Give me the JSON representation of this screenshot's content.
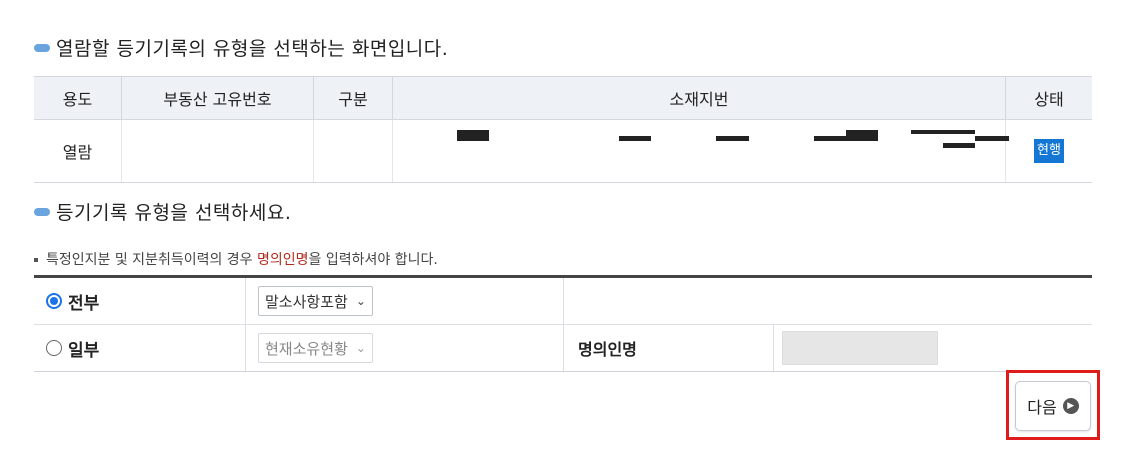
{
  "titles": {
    "main": "열람할 등기기록의 유형을 선택하는 화면입니다.",
    "select_type": "등기기록 유형을 선택하세요."
  },
  "info_table": {
    "headers": [
      "용도",
      "부동산 고유번호",
      "구분",
      "소재지번",
      "상태"
    ],
    "row": {
      "purpose": "열람",
      "unique_no": "",
      "category": "",
      "address": "",
      "status": "현행"
    }
  },
  "note": {
    "prefix": "특정인지분 및 지분취득이력의 경우 ",
    "highlight": "명의인명",
    "suffix": "을 입력하셔야 합니다."
  },
  "options": {
    "all": {
      "label": "전부",
      "selected": true,
      "dropdown": "말소사항포함"
    },
    "partial": {
      "label": "일부",
      "selected": false,
      "dropdown": "현재소유현황",
      "owner_label": "명의인명",
      "owner_value": ""
    }
  },
  "next_button": {
    "label": "다음"
  },
  "colors": {
    "accent_blue": "#1577d4",
    "highlight_red": "#e01b1b",
    "note_red": "#b12a1c",
    "header_bg": "#eef1f5"
  }
}
